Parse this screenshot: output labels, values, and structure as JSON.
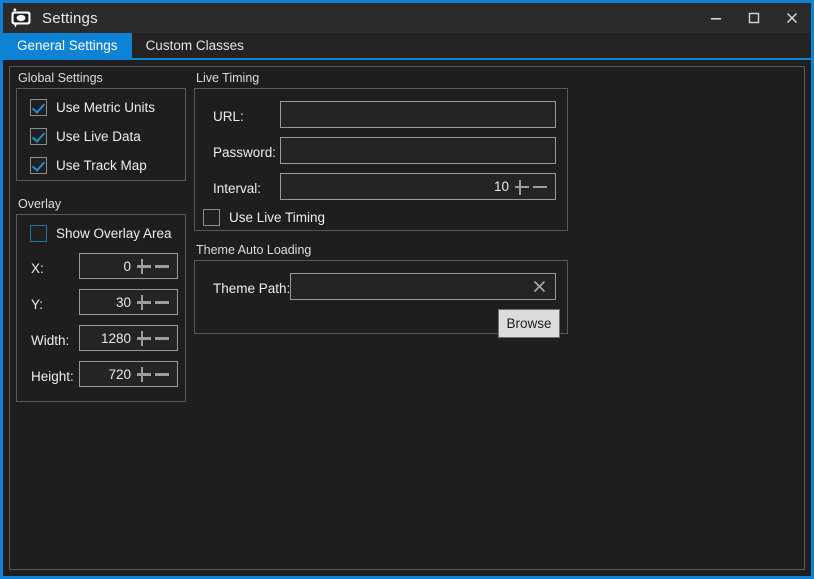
{
  "window": {
    "title": "Settings",
    "icon": "app-camera-icon",
    "accent_color": "#0e82d4",
    "background_color": "#1f1f1f",
    "controls": {
      "minimize": "–",
      "maximize": "☐",
      "close": "✕"
    }
  },
  "tabs": [
    {
      "label": "General Settings",
      "active": true
    },
    {
      "label": "Custom Classes",
      "active": false
    }
  ],
  "global_settings": {
    "title": "Global Settings",
    "checkboxes": [
      {
        "label": "Use Metric Units",
        "checked": true
      },
      {
        "label": "Use Live Data",
        "checked": true
      },
      {
        "label": "Use Track Map",
        "checked": true
      }
    ]
  },
  "overlay": {
    "title": "Overlay",
    "show_overlay_area": {
      "label": "Show Overlay Area",
      "checked": false
    },
    "fields": [
      {
        "label": "X:",
        "value": "0"
      },
      {
        "label": "Y:",
        "value": "30"
      },
      {
        "label": "Width:",
        "value": "1280"
      },
      {
        "label": "Height:",
        "value": "720"
      }
    ],
    "spinner_increment": "+",
    "spinner_decrement": "−"
  },
  "live_timing": {
    "title": "Live Timing",
    "url": {
      "label": "URL:",
      "value": "",
      "placeholder": ""
    },
    "password": {
      "label": "Password:",
      "value": "",
      "placeholder": ""
    },
    "interval": {
      "label": "Interval:",
      "value": "10"
    },
    "use_live_timing": {
      "label": "Use Live Timing",
      "checked": false
    }
  },
  "theme_auto_loading": {
    "title": "Theme Auto Loading",
    "theme_path": {
      "label": "Theme Path:",
      "value": "",
      "placeholder": "",
      "clear_icon": "✕"
    },
    "browse_button": "Browse"
  }
}
